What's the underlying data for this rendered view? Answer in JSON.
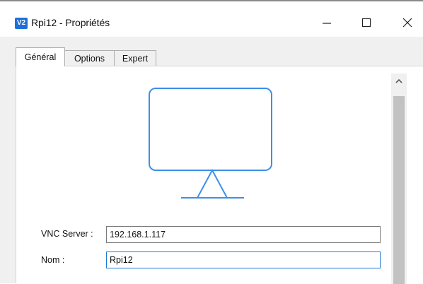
{
  "window": {
    "title": "Rpi12 - Propriétés",
    "app_icon_text": "V2",
    "accent_color": "#1f6fd6"
  },
  "window_controls": {
    "minimize_icon": "minimize-icon",
    "maximize_icon": "maximize-icon",
    "close_icon": "close-icon"
  },
  "tabs": [
    {
      "label": "Général",
      "active": true
    },
    {
      "label": "Options",
      "active": false
    },
    {
      "label": "Expert",
      "active": false
    }
  ],
  "general": {
    "monitor_icon": "monitor-icon",
    "monitor_color": "#3d8fe8",
    "vnc_server_label": "VNC Server :",
    "vnc_server_value": "192.168.1.117",
    "nom_label": "Nom :",
    "nom_value": "Rpi12"
  }
}
